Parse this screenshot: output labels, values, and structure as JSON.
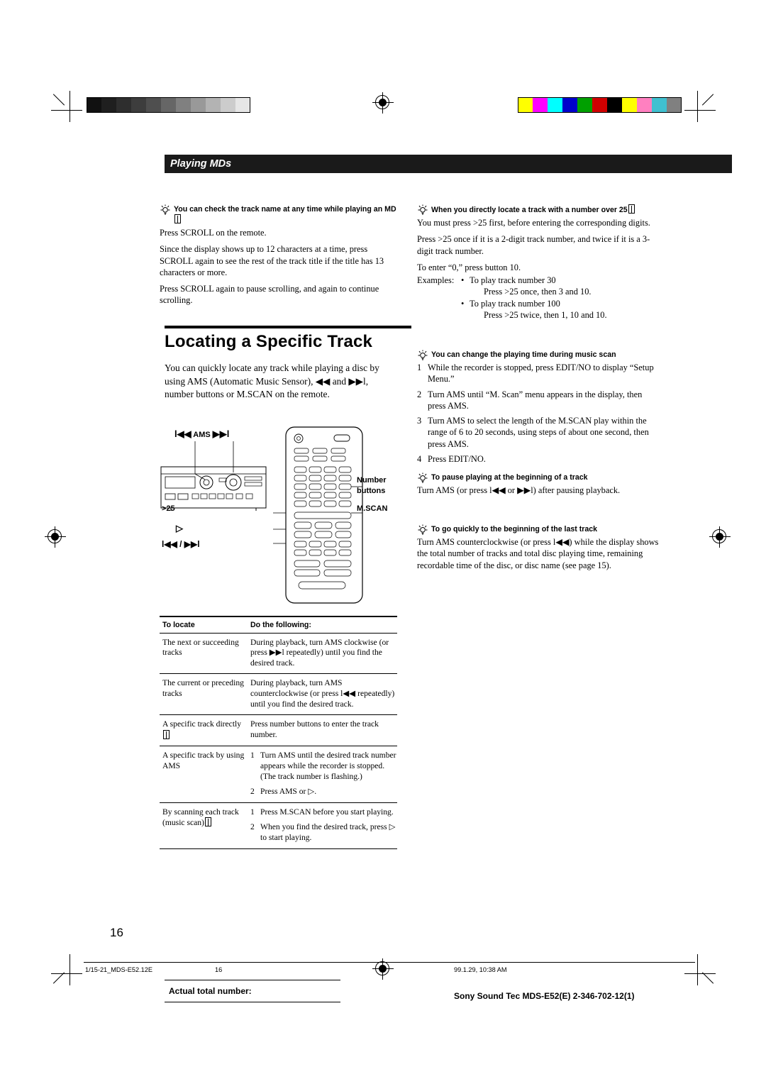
{
  "header": {
    "section": "Playing MDs"
  },
  "tips_left": [
    {
      "title": "You can check the track name at any time while playing an MD",
      "icon": "lightbulb-icon",
      "has_book_icon": true,
      "paragraphs": [
        "Press SCROLL on the remote.",
        "Since the display shows up to 12 characters at a time, press SCROLL again to see the rest of the track title if the title has 13 characters or more.",
        "Press SCROLL again to pause scrolling, and again to continue scrolling."
      ]
    }
  ],
  "main": {
    "title": "Locating a Specific Track",
    "intro": "You can quickly locate any track while playing a disc by using AMS (Automatic Music Sensor), ◀◀ and ▶▶l, number buttons or M.SCAN on the remote."
  },
  "illustration": {
    "ams_label": "AMS",
    "number_buttons_label_line1": "Number",
    "number_buttons_label_line2": "buttons",
    "gt25_label": ">25",
    "mscan_label": "M.SCAN",
    "play_label": "▷",
    "skip_label": "l◀◀ / ▶▶l"
  },
  "table": {
    "headers": [
      "To locate",
      "Do the following:"
    ],
    "rows": [
      {
        "locate": "The next or succeeding tracks",
        "do": "During playback, turn AMS clockwise (or press ▶▶l repeatedly) until you find the desired track.",
        "steps": []
      },
      {
        "locate": "The current or preceding tracks",
        "do": "During playback, turn AMS counterclockwise (or press l◀◀ repeatedly) until you find the desired track.",
        "steps": []
      },
      {
        "locate": "A specific track directly",
        "locate_icon": true,
        "do": "Press number buttons to enter the track number.",
        "steps": []
      },
      {
        "locate": "A specific track by using AMS",
        "do": "",
        "steps": [
          "Turn AMS until the desired track number appears while the recorder is stopped.  (The track number is flashing.)",
          "Press AMS or ▷."
        ]
      },
      {
        "locate": "By scanning each track (music scan)",
        "locate_icon": true,
        "do": "",
        "steps": [
          "Press M.SCAN before you start playing.",
          "When you find the desired track, press ▷ to start playing."
        ]
      }
    ]
  },
  "tips_right": [
    {
      "title": "When you directly locate a track with a number over 25",
      "icon": "lightbulb-icon",
      "has_book_icon": true,
      "paragraphs": [
        "You must press >25 first, before entering the corresponding digits.",
        "Press >25 once if it is a 2-digit track number, and twice if it is a 3-digit track number.",
        "To enter “0,” press button 10."
      ],
      "examples_label": "Examples:",
      "examples": [
        {
          "bullet": "To play track number 30",
          "detail": "Press >25 once, then 3 and 10."
        },
        {
          "bullet": "To play track number 100",
          "detail": "Press >25 twice, then 1, 10 and 10."
        }
      ]
    },
    {
      "title": "You can change the playing time during music scan",
      "icon": "lightbulb-icon",
      "steps": [
        "While the recorder is stopped, press EDIT/NO to display “Setup Menu.”",
        "Turn AMS until “M. Scan” menu appears in the display, then press AMS.",
        "Turn AMS to select the length of the M.SCAN play within the range of 6 to 20 seconds, using steps of about one second, then press AMS.",
        "Press EDIT/NO."
      ]
    },
    {
      "title": "To pause playing at the beginning of a track",
      "icon": "lightbulb-icon",
      "paragraphs": [
        "Turn AMS (or press l◀◀ or ▶▶l) after pausing playback."
      ]
    },
    {
      "title": "To go quickly to the beginning of the last track",
      "icon": "lightbulb-icon",
      "paragraphs": [
        "Turn AMS counterclockwise (or press l◀◀) while the display shows the total number of tracks and total disc playing time, remaining recordable time of the disc, or disc name (see page 15)."
      ]
    }
  ],
  "footer": {
    "page_number": "16",
    "file_id": "1/15-21_MDS-E52.12E",
    "page_mark": "16",
    "timestamp": "99.1.29, 10:38 AM",
    "actual_total": "Actual total number:",
    "model": "Sony Sound Tec MDS-E52(E) 2-346-702-12(1)"
  },
  "colors": {
    "gray_steps": [
      "#111111",
      "#1f1f1f",
      "#2e2e2e",
      "#3d3d3d",
      "#4f4f4f",
      "#666666",
      "#808080",
      "#999999",
      "#b3b3b3",
      "#cccccc",
      "#e6e6e6"
    ],
    "color_steps": [
      "#ffff00",
      "#ff00ff",
      "#00ffff",
      "#0000cc",
      "#00a000",
      "#d00000",
      "#000000",
      "#ffff00",
      "#ff80c0",
      "#40c0d0",
      "#808080"
    ]
  }
}
